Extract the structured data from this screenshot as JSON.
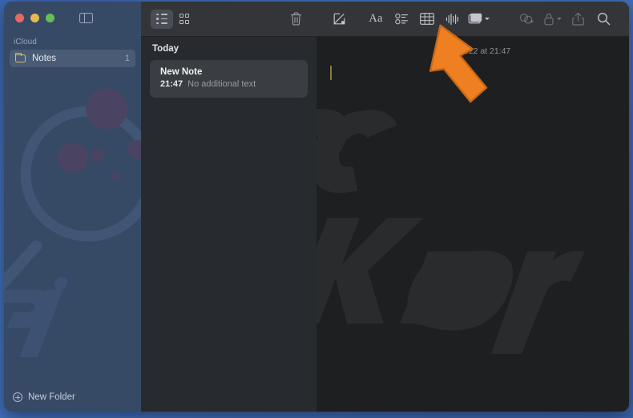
{
  "window": {
    "traffic_lights": [
      "close",
      "minimize",
      "zoom"
    ],
    "sidebar_toggle_icon": "sidebar-toggle-icon"
  },
  "sidebar": {
    "section_label": "iCloud",
    "items": [
      {
        "icon": "folder-icon",
        "label": "Notes",
        "count": "1",
        "selected": true
      }
    ],
    "footer": {
      "icon": "plus-circle-icon",
      "label": "New Folder"
    }
  },
  "notelist": {
    "toolbar": {
      "list_view_icon": "list-view-icon",
      "gallery_view_icon": "gallery-view-icon",
      "delete_icon": "trash-icon"
    },
    "group_header": "Today",
    "notes": [
      {
        "title": "New Note",
        "time": "21:47",
        "preview": "No additional text",
        "selected": true
      }
    ]
  },
  "editor": {
    "toolbar": {
      "compose_label": "compose-icon",
      "format_label": "Aa",
      "checklist_label": "checklist-icon",
      "table_label": "table-icon",
      "quicknote_label": "audio-waveform-icon",
      "media_label": "media-icon",
      "media_chevron": "chevron-down-icon",
      "collaborate_label": "collaborate-icon",
      "lock_label": "lock-icon",
      "lock_chevron": "chevron-down-icon",
      "share_label": "share-icon",
      "search_label": "search-icon"
    },
    "note_date": "7 July 2022 at 21:47",
    "body_text": ""
  },
  "watermark": {
    "text": "pcrisk.com"
  },
  "cursor": {
    "name": "orange-arrow-pointer",
    "color": "#ef8022"
  },
  "colors": {
    "desktop": "#3d68b4",
    "sidebar": "#364a66",
    "notelist": "#272a2e",
    "editor": "#1e1f21",
    "toolbar": "#333539",
    "selection": "#3a3d42",
    "accent_caret": "#8a7a3a"
  }
}
